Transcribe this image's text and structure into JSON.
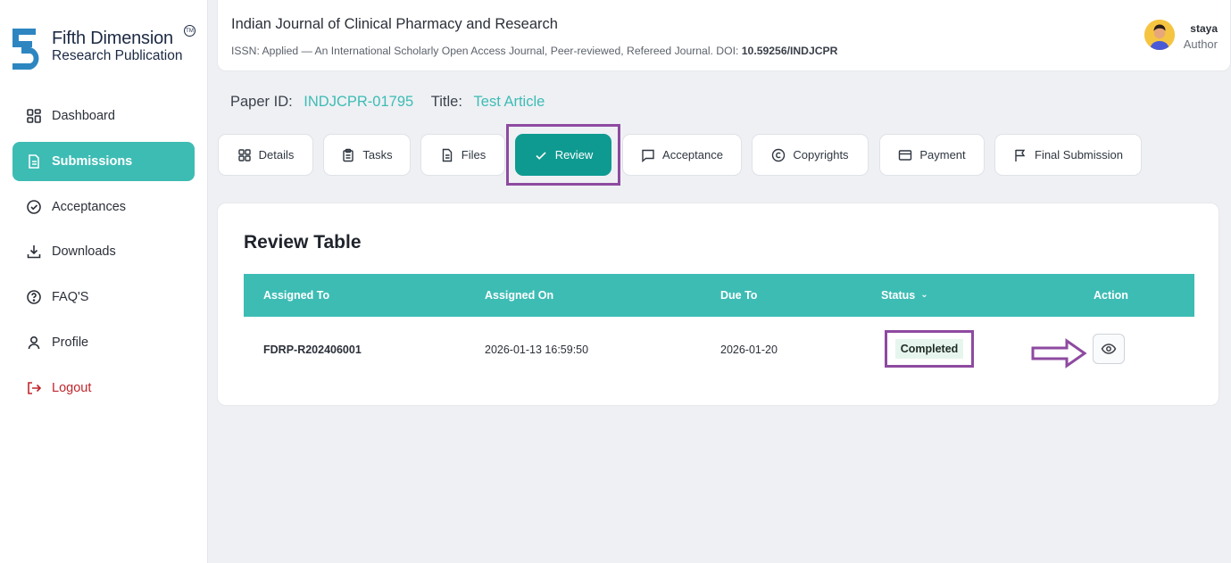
{
  "brand": {
    "title": "Fifth Dimension",
    "subtitle": "Research Publication",
    "tm": "TM"
  },
  "sidebar": {
    "items": [
      {
        "label": "Dashboard",
        "icon": "grid-icon"
      },
      {
        "label": "Submissions",
        "icon": "document-icon",
        "active": true
      },
      {
        "label": "Acceptances",
        "icon": "check-circle-icon"
      },
      {
        "label": "Downloads",
        "icon": "download-icon"
      },
      {
        "label": "FAQ'S",
        "icon": "help-circle-icon"
      },
      {
        "label": "Profile",
        "icon": "user-icon"
      },
      {
        "label": "Logout",
        "icon": "logout-icon"
      }
    ]
  },
  "header": {
    "journal_title": "Indian Journal of Clinical Pharmacy and Research",
    "journal_sub": "ISSN: Applied — An International Scholarly Open Access Journal, Peer-reviewed, Refereed Journal. DOI: ",
    "doi": "10.59256/INDJCPR",
    "user_name": "staya",
    "user_role": "Author"
  },
  "paper": {
    "id_label": "Paper ID:",
    "id_value": "INDJCPR-01795",
    "title_label": "Title:",
    "title_value": "Test Article"
  },
  "tabs": [
    {
      "label": "Details",
      "icon": "grid-icon"
    },
    {
      "label": "Tasks",
      "icon": "clipboard-icon"
    },
    {
      "label": "Files",
      "icon": "file-icon"
    },
    {
      "label": "Review",
      "icon": "check-icon",
      "active": true
    },
    {
      "label": "Acceptance",
      "icon": "message-icon"
    },
    {
      "label": "Copyrights",
      "icon": "copyright-icon"
    },
    {
      "label": "Payment",
      "icon": "credit-card-icon"
    },
    {
      "label": "Final Submission",
      "icon": "flag-icon"
    }
  ],
  "review": {
    "title": "Review Table",
    "columns": [
      "Assigned To",
      "Assigned On",
      "Due To",
      "Status",
      "Action"
    ],
    "rows": [
      {
        "assigned_to": "FDRP-R202406001",
        "assigned_on": "2026-01-13 16:59:50",
        "due_to": "2026-01-20",
        "status": "Completed"
      }
    ]
  },
  "colors": {
    "accent": "#3dbcb4",
    "accent_dark": "#0f9a91",
    "highlight": "#8e4aa0",
    "logout": "#c0262d"
  }
}
